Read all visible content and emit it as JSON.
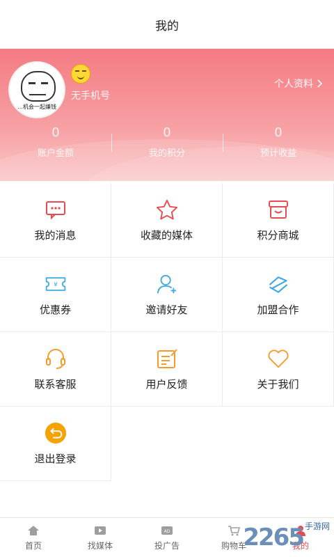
{
  "topbar": {
    "title": "我的"
  },
  "header": {
    "avatar_caption": "…机会一起嫌钱",
    "phone": "无手机号",
    "profile_link": "个人资料",
    "stats": [
      {
        "value": "0",
        "label": "账户金额"
      },
      {
        "value": "0",
        "label": "我的积分"
      },
      {
        "value": "0",
        "label": "预计收益"
      }
    ]
  },
  "menu": [
    {
      "label": "我的消息",
      "icon": "message-icon"
    },
    {
      "label": "收藏的媒体",
      "icon": "star-icon"
    },
    {
      "label": "积分商城",
      "icon": "store-icon"
    },
    {
      "label": "优惠券",
      "icon": "coupon-icon"
    },
    {
      "label": "邀请好友",
      "icon": "add-user-icon"
    },
    {
      "label": "加盟合作",
      "icon": "partner-icon"
    },
    {
      "label": "联系客服",
      "icon": "headset-icon"
    },
    {
      "label": "用户反馈",
      "icon": "feedback-icon"
    },
    {
      "label": "关于我们",
      "icon": "heart-icon"
    },
    {
      "label": "退出登录",
      "icon": "logout-icon"
    }
  ],
  "tabs": [
    {
      "label": "首页",
      "icon": "home-icon"
    },
    {
      "label": "找媒体",
      "icon": "media-icon"
    },
    {
      "label": "投广告",
      "icon": "ad-icon"
    },
    {
      "label": "购物车",
      "icon": "cart-icon"
    },
    {
      "label": "我的",
      "icon": "user-icon"
    }
  ],
  "watermark": {
    "number": "2265",
    "text": "手游网"
  },
  "colors": {
    "accent": "#e94a4e",
    "header": "#f47b82",
    "blue": "#3fa9e0",
    "orange": "#f39c2b"
  }
}
